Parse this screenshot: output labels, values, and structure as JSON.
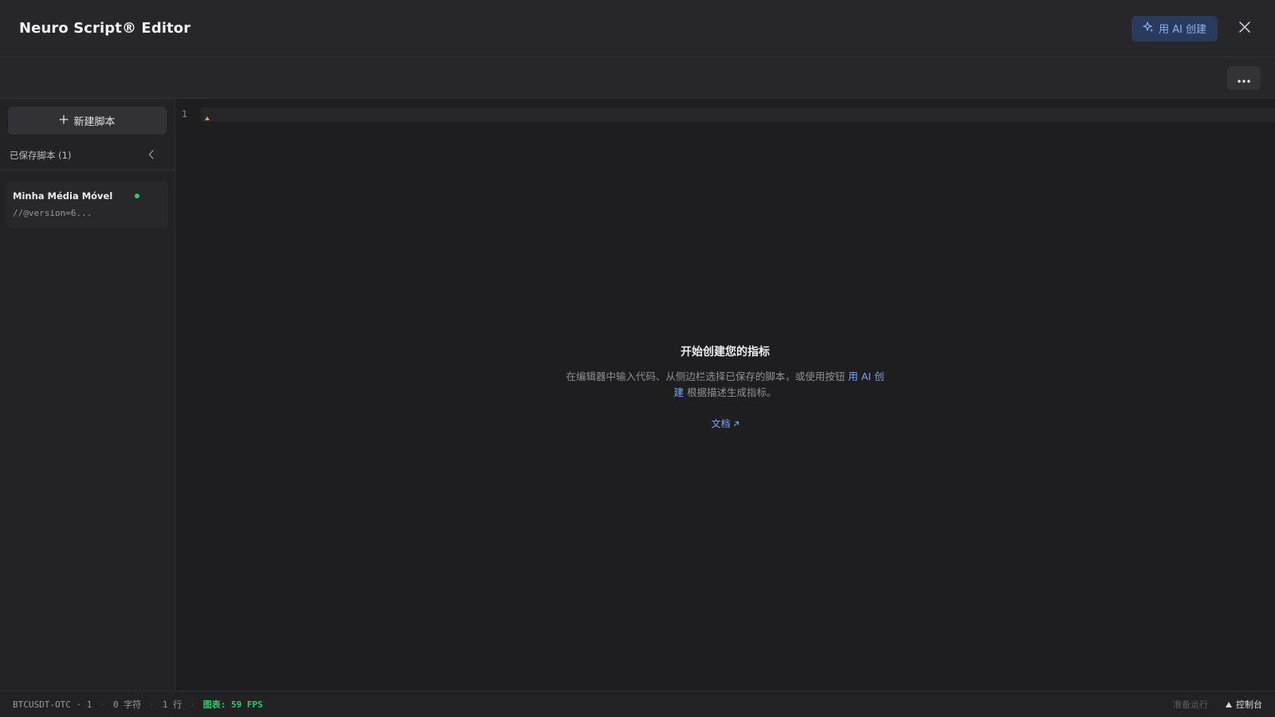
{
  "app": {
    "title": "Neuro Script® Editor"
  },
  "header": {
    "ai_button_label": "用 AI 创建",
    "ai_icon": "sparkle-icon",
    "close_icon": "close-icon"
  },
  "toolbar": {
    "more_icon": "more-horizontal-icon"
  },
  "sidebar": {
    "new_script_label": "新建脚本",
    "saved_label": "已保存脚本 (1)",
    "collapse_icon": "chevron-left-icon",
    "scripts": [
      {
        "name": "Minha Média Móvel",
        "preview": "//@version=6...",
        "status_color": "#34c66b"
      }
    ]
  },
  "editor": {
    "line_numbers": [
      "1"
    ],
    "empty_state": {
      "title": "开始创建您的指标",
      "desc_before": "在编辑器中输入代码、从侧边栏选择已保存的脚本，或使用按钮 ",
      "desc_link": "用 AI 创建",
      "desc_after": " 根据描述生成指标。",
      "docs_label": "文档"
    }
  },
  "statusbar": {
    "symbol": "BTCUSDT-OTC · 1",
    "chars": "0 字符",
    "lines": "1 行",
    "fps": "图表: 59 FPS",
    "ready": "准备运行",
    "console_label": "控制台"
  },
  "colors": {
    "accent": "#7aa6f0",
    "success": "#34c66b",
    "warning": "#e3a034"
  }
}
